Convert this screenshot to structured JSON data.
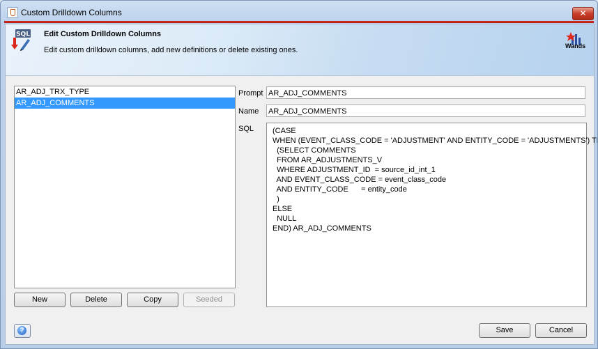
{
  "window": {
    "title": "Custom Drilldown Columns",
    "close_label": "✕"
  },
  "banner": {
    "title": "Edit Custom Drilldown Columns",
    "description": "Edit custom drilldown columns, add new definitions or delete existing ones.",
    "icon_text": "SQL",
    "logo_text": "Wands"
  },
  "list": {
    "items": [
      {
        "label": "AR_ADJ_TRX_TYPE",
        "selected": false
      },
      {
        "label": "AR_ADJ_COMMENTS",
        "selected": true
      }
    ]
  },
  "buttons": {
    "new": "New",
    "delete": "Delete",
    "copy": "Copy",
    "seeded": "Seeded",
    "save": "Save",
    "cancel": "Cancel"
  },
  "form": {
    "prompt_label": "Prompt",
    "prompt_value": "AR_ADJ_COMMENTS",
    "name_label": "Name",
    "name_value": "AR_ADJ_COMMENTS",
    "sql_label": "SQL",
    "sql_lines": [
      "(CASE",
      "WHEN (EVENT_CLASS_CODE = 'ADJUSTMENT' AND ENTITY_CODE = 'ADJUSTMENTS') THEN",
      "  (SELECT COMMENTS",
      "  FROM AR_ADJUSTMENTS_V",
      "  WHERE ADJUSTMENT_ID  = source_id_int_1",
      "  AND EVENT_CLASS_CODE = event_class_code",
      "  AND ENTITY_CODE      = entity_code",
      "  )",
      "ELSE",
      "  NULL",
      "END) AR_ADJ_COMMENTS"
    ]
  },
  "help": {
    "icon_glyph": "?"
  }
}
